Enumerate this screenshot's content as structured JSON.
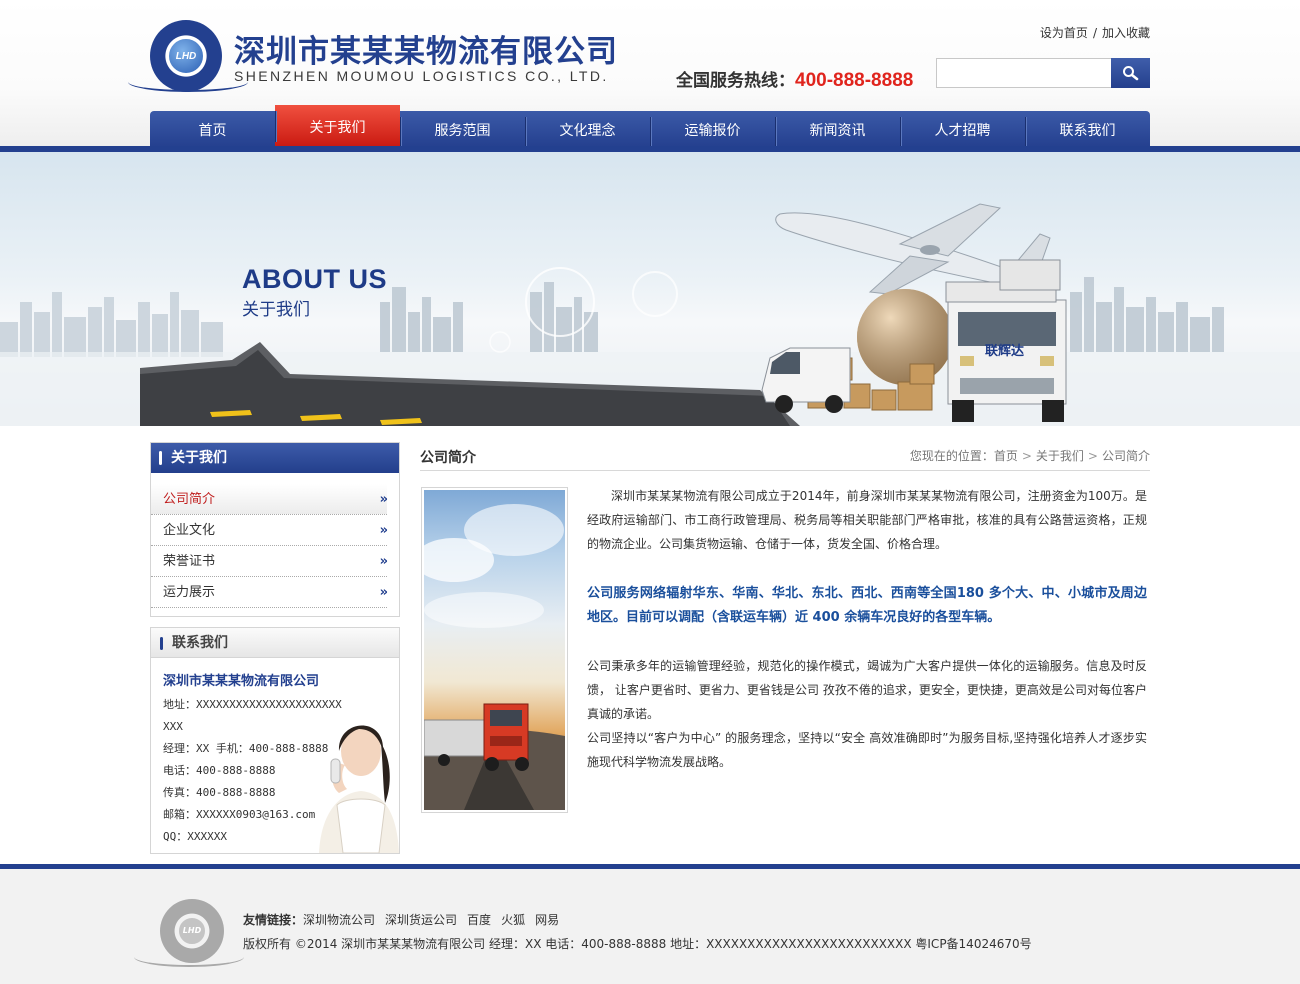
{
  "header": {
    "company_cn": "深圳市某某某物流有限公司",
    "company_en": "SHENZHEN MOUMOU LOGISTICS CO., LTD.",
    "logo_text": "LHD",
    "top_links": [
      "设为首页",
      "加入收藏"
    ],
    "top_link_sep": "/",
    "hotline_label": "全国服务热线：",
    "hotline_number": "400-888-8888",
    "search_placeholder": ""
  },
  "nav": {
    "items": [
      "首页",
      "关于我们",
      "服务范围",
      "文化理念",
      "运输报价",
      "新闻资讯",
      "人才招聘",
      "联系我们"
    ],
    "active_index": 1
  },
  "banner": {
    "title_en": "ABOUT US",
    "title_cn": "关于我们",
    "truck_label": "联辉达"
  },
  "sidebar": {
    "about_title": "关于我们",
    "menu": [
      "公司简介",
      "企业文化",
      "荣誉证书",
      "运力展示"
    ],
    "active_index": 0,
    "arrow": "»",
    "contact_title": "联系我们",
    "contact_company": "深圳市某某某物流有限公司",
    "contact": {
      "address": "地址：XXXXXXXXXXXXXXXXXXXXXXXXX",
      "manager": "经理：XX 手机：400-888-8888",
      "phone": "电话：400-888-8888",
      "fax": "传真：400-888-8888",
      "email": "邮箱：XXXXXX0903@163.com",
      "qq": "QQ：XXXXXX"
    }
  },
  "main": {
    "title": "公司简介",
    "breadcrumb_label": "您现在的位置：",
    "breadcrumb": [
      "首页",
      "关于我们",
      "公司简介"
    ],
    "breadcrumb_sep": ">",
    "para1": "深圳市某某某物流有限公司成立于2014年，前身深圳市某某某物流有限公司，注册资金为100万。是经政府运输部门、市工商行政管理局、税务局等相关职能部门严格审批，核准的具有公路营运资格，正规的物流企业。公司集货物运输、仓储于一体，货发全国、价格合理。",
    "para2": "公司服务网络辐射华东、华南、华北、东北、西北、西南等全国180  多个大、中、小城市及周边地区。目前可以调配（含联运车辆）近  400  余辆车况良好的各型车辆。",
    "para3": "公司秉承多年的运输管理经验，规范化的操作模式，竭诚为广大客户提供一体化的运输服务。信息及时反馈， 让客户更省时、更省力、更省钱是公司  孜孜不倦的追求，更安全，更快捷，更高效是公司对每位客户真诚的承诺。",
    "para4": "公司坚持以“客户为中心” 的服务理念，坚持以“安全  高效准确即时”为服务目标,坚持强化培养人才逐步实施现代科学物流发展战略。"
  },
  "footer": {
    "links_label": "友情链接：",
    "links": [
      "深圳物流公司",
      "深圳货运公司",
      "百度",
      "火狐",
      "网易"
    ],
    "copyright": "版权所有 ©2014 深圳市某某某物流有限公司  经理：XX  电话：400-888-8888  地址：XXXXXXXXXXXXXXXXXXXXXXXXX 粤ICP备14024670号"
  },
  "colors": {
    "brand_blue": "#23408f",
    "nav_active_red": "#d72a1e",
    "hotline_red": "#e0241d",
    "highlight_blue": "#1a4f9c"
  }
}
